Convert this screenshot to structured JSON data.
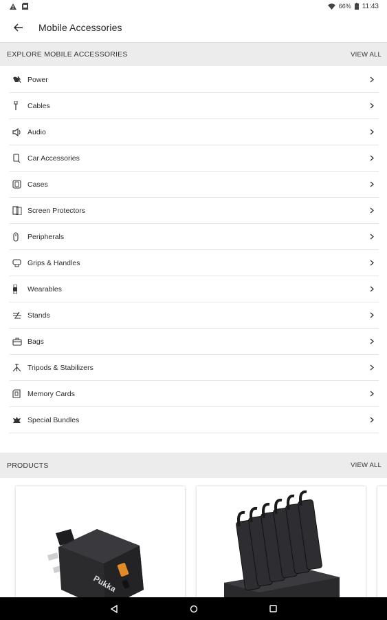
{
  "status_bar": {
    "battery": "66%",
    "time": "11:43"
  },
  "app_bar": {
    "title": "Mobile Accessories"
  },
  "explore": {
    "header": "EXPLORE MOBILE ACCESSORIES",
    "view_all": "VIEW ALL",
    "items": [
      {
        "label": "Power",
        "icon": "power-icon"
      },
      {
        "label": "Cables",
        "icon": "cable-icon"
      },
      {
        "label": "Audio",
        "icon": "audio-icon"
      },
      {
        "label": "Car Accessories",
        "icon": "car-accessories-icon"
      },
      {
        "label": "Cases",
        "icon": "case-icon"
      },
      {
        "label": "Screen Protectors",
        "icon": "screen-protector-icon"
      },
      {
        "label": "Peripherals",
        "icon": "peripherals-icon"
      },
      {
        "label": "Grips & Handles",
        "icon": "grip-icon"
      },
      {
        "label": "Wearables",
        "icon": "wearables-icon"
      },
      {
        "label": "Stands",
        "icon": "stand-icon"
      },
      {
        "label": "Bags",
        "icon": "bag-icon"
      },
      {
        "label": "Tripods & Stabilizers",
        "icon": "tripod-icon"
      },
      {
        "label": "Memory Cards",
        "icon": "memory-card-icon"
      },
      {
        "label": "Special Bundles",
        "icon": "bundle-icon"
      }
    ]
  },
  "products": {
    "header": "PRODUCTS",
    "view_all": "VIEW ALL",
    "items": [
      {
        "image": "wall-charger-image",
        "brand_print": "Pukka"
      },
      {
        "image": "power-bank-dock-image"
      }
    ]
  },
  "nav_bar": {
    "buttons": [
      "back-nav-icon",
      "home-nav-icon",
      "recents-nav-icon"
    ]
  }
}
